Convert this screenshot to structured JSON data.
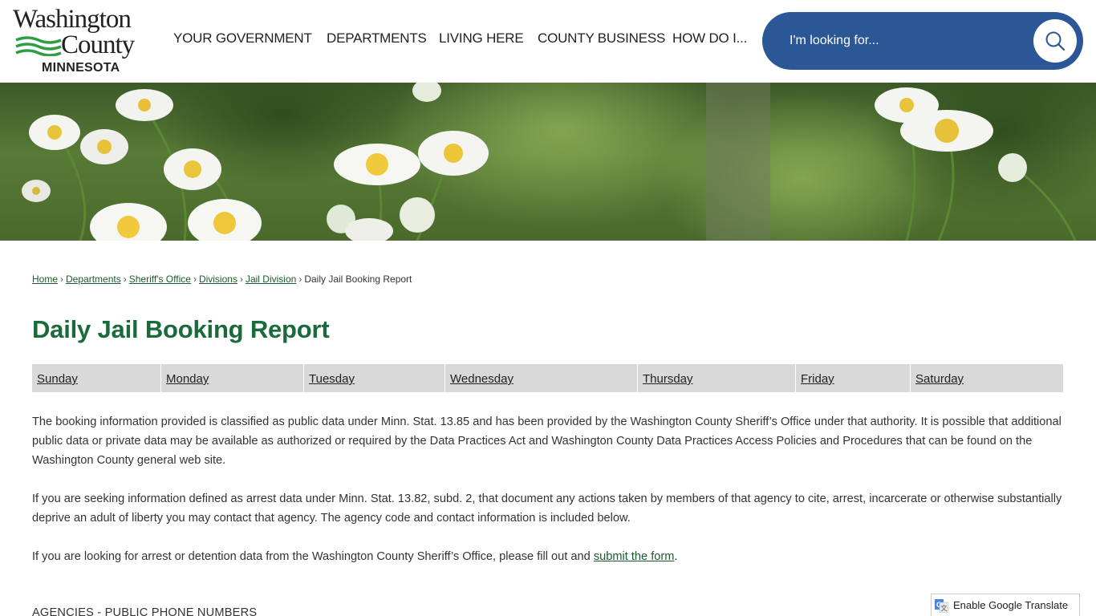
{
  "logo": {
    "line1": "Washington",
    "line2": "County",
    "line3": "MINNESOTA"
  },
  "nav": {
    "items": [
      {
        "label": "YOUR GOVERNMENT"
      },
      {
        "label": "DEPARTMENTS"
      },
      {
        "label": "LIVING HERE"
      },
      {
        "label": "COUNTY BUSINESS"
      },
      {
        "label": "HOW DO I..."
      }
    ]
  },
  "search": {
    "placeholder": "I'm looking for..."
  },
  "breadcrumb": {
    "items": [
      {
        "label": "Home"
      },
      {
        "label": "Departments"
      },
      {
        "label": "Sheriff's Office"
      },
      {
        "label": "Divisions"
      },
      {
        "label": "Jail Division"
      }
    ],
    "current": "Daily Jail Booking Report"
  },
  "page": {
    "title": "Daily Jail Booking Report"
  },
  "days": [
    {
      "label": "Sunday"
    },
    {
      "label": "Monday"
    },
    {
      "label": "Tuesday"
    },
    {
      "label": "Wednesday"
    },
    {
      "label": "Thursday"
    },
    {
      "label": "Friday"
    },
    {
      "label": "Saturday"
    }
  ],
  "content": {
    "para1": "The booking information provided is classified as public data under Minn. Stat. 13.85 and has been provided by the Washington County Sheriff’s Office under that authority. It is possible that additional public data or private data may be available as authorized or required by the Data Practices Act and Washington County Data Practices Access Policies and Procedures that can be found on the Washington County general web site.",
    "para2": "If you are seeking information defined as arrest data under Minn. Stat. 13.82, subd. 2, that document any actions taken by members of that agency to cite, arrest, incarcerate or otherwise substantially deprive an adult of liberty you may contact that agency. The agency code and contact information is included below.",
    "para3_before": "If you are looking for arrest or detention data from the Washington County Sheriff’s Office, please fill out and ",
    "para3_link": "submit the form",
    "para3_after": ".",
    "agencies_heading": "AGENCIES - PUBLIC PHONE NUMBERS"
  },
  "translate": {
    "label": "Enable Google Translate"
  },
  "colors": {
    "brand_green": "#1a6b3c",
    "link_green": "#1a5b2a",
    "search_blue": "#2b5797",
    "day_bar": "#d9d9d9"
  },
  "icons": {
    "search": "search-icon",
    "translate": "google-translate-icon",
    "logo_waves": "wave-icon"
  }
}
